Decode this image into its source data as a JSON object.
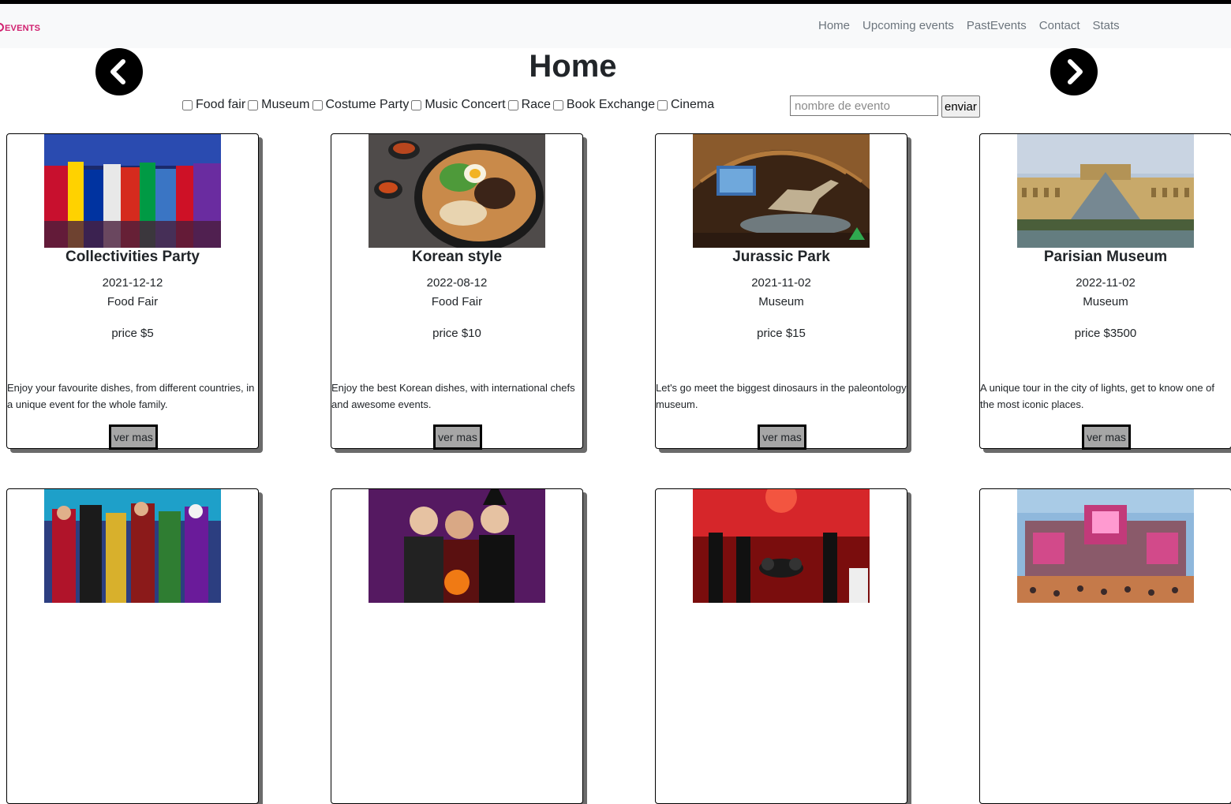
{
  "brand": {
    "logo_text": "EVENTS"
  },
  "nav": {
    "links": [
      {
        "label": "Home"
      },
      {
        "label": "Upcoming events"
      },
      {
        "label": "PastEvents"
      },
      {
        "label": "Contact"
      },
      {
        "label": "Stats"
      }
    ]
  },
  "page": {
    "title": "Home"
  },
  "icons": {
    "prev": "chevron-left-icon",
    "next": "chevron-right-icon"
  },
  "filters": {
    "categories": [
      {
        "label": "Food fair",
        "checked": false
      },
      {
        "label": "Museum",
        "checked": false
      },
      {
        "label": "Costume Party",
        "checked": false
      },
      {
        "label": "Music Concert",
        "checked": false
      },
      {
        "label": "Race",
        "checked": false
      },
      {
        "label": "Book Exchange",
        "checked": false
      },
      {
        "label": "Cinema",
        "checked": false
      }
    ]
  },
  "search": {
    "placeholder": "nombre de evento",
    "value": "",
    "submit_label": "enviar"
  },
  "cards": [
    {
      "title": "Collectivities Party",
      "date": "2021-12-12",
      "category": "Food Fair",
      "price": "price $5",
      "description": "Enjoy your favourite dishes, from different countries, in a unique event for the whole family.",
      "button_label": "ver mas",
      "image": "festival-flags-photo"
    },
    {
      "title": "Korean style",
      "date": "2022-08-12",
      "category": "Food Fair",
      "price": "price $10",
      "description": "Enjoy the best Korean dishes, with international chefs and awesome events.",
      "button_label": "ver mas",
      "image": "bibimbap-photo"
    },
    {
      "title": "Jurassic Park",
      "date": "2021-11-02",
      "category": "Museum",
      "price": "price $15",
      "description": "Let's go meet the biggest dinosaurs in the paleontology museum.",
      "button_label": "ver mas",
      "image": "dinosaur-museum-photo"
    },
    {
      "title": "Parisian Museum",
      "date": "2022-11-02",
      "category": "Museum",
      "price": "price $3500",
      "description": "A unique tour in the city of lights, get to know one of the most iconic places.",
      "button_label": "ver mas",
      "image": "louvre-photo"
    },
    {
      "image": "cosplay-photo"
    },
    {
      "image": "halloween-party-photo"
    },
    {
      "image": "rock-concert-photo"
    },
    {
      "image": "music-festival-stage-photo"
    }
  ],
  "colors": {
    "brand": "#d01f6e",
    "navbar_bg": "#f8f9fa",
    "nav_link": "#6c757d",
    "button_bg": "#a6a6a6",
    "card_shadow": "#6b6b6b"
  }
}
